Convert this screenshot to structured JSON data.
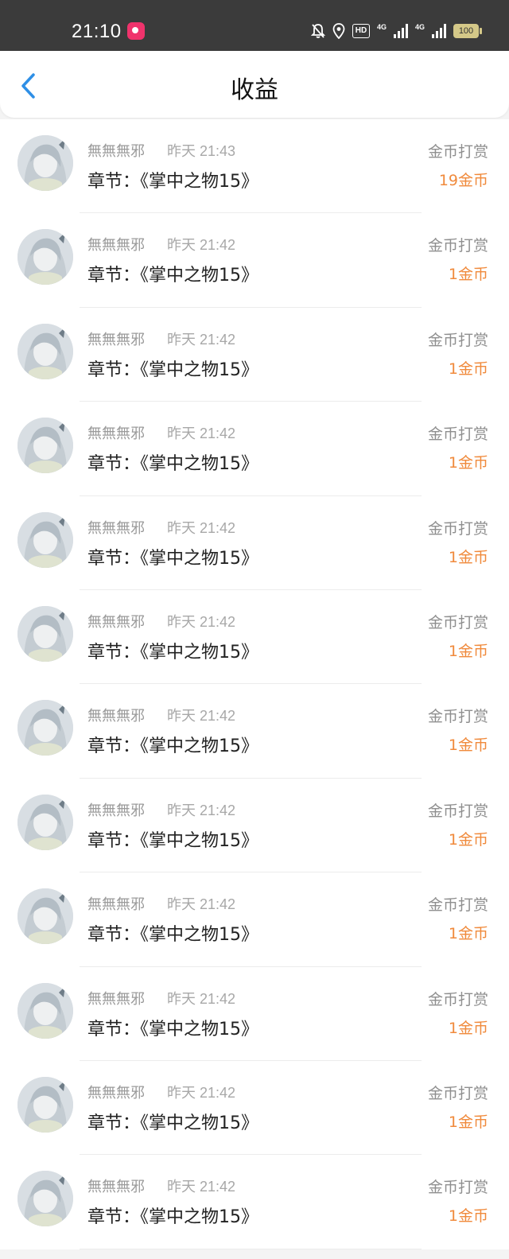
{
  "status_bar": {
    "time": "21:10",
    "hd_label": "HD",
    "net1": "4G",
    "net2": "4G",
    "battery": "100"
  },
  "header": {
    "title": "收益",
    "back_icon": "chevron-left-icon"
  },
  "colors": {
    "accent_back": "#2e8fe6",
    "amount": "#f08a3c",
    "status_bar_bg": "#3b3b3b"
  },
  "records": [
    {
      "user": "無無無邪",
      "time": "昨天 21:43",
      "chapter": "章节：《掌中之物15》",
      "type": "金币打赏",
      "amount": "19金币"
    },
    {
      "user": "無無無邪",
      "time": "昨天 21:42",
      "chapter": "章节：《掌中之物15》",
      "type": "金币打赏",
      "amount": "1金币"
    },
    {
      "user": "無無無邪",
      "time": "昨天 21:42",
      "chapter": "章节：《掌中之物15》",
      "type": "金币打赏",
      "amount": "1金币"
    },
    {
      "user": "無無無邪",
      "time": "昨天 21:42",
      "chapter": "章节：《掌中之物15》",
      "type": "金币打赏",
      "amount": "1金币"
    },
    {
      "user": "無無無邪",
      "time": "昨天 21:42",
      "chapter": "章节：《掌中之物15》",
      "type": "金币打赏",
      "amount": "1金币"
    },
    {
      "user": "無無無邪",
      "time": "昨天 21:42",
      "chapter": "章节：《掌中之物15》",
      "type": "金币打赏",
      "amount": "1金币"
    },
    {
      "user": "無無無邪",
      "time": "昨天 21:42",
      "chapter": "章节：《掌中之物15》",
      "type": "金币打赏",
      "amount": "1金币"
    },
    {
      "user": "無無無邪",
      "time": "昨天 21:42",
      "chapter": "章节：《掌中之物15》",
      "type": "金币打赏",
      "amount": "1金币"
    },
    {
      "user": "無無無邪",
      "time": "昨天 21:42",
      "chapter": "章节：《掌中之物15》",
      "type": "金币打赏",
      "amount": "1金币"
    },
    {
      "user": "無無無邪",
      "time": "昨天 21:42",
      "chapter": "章节：《掌中之物15》",
      "type": "金币打赏",
      "amount": "1金币"
    },
    {
      "user": "無無無邪",
      "time": "昨天 21:42",
      "chapter": "章节：《掌中之物15》",
      "type": "金币打赏",
      "amount": "1金币"
    },
    {
      "user": "無無無邪",
      "time": "昨天 21:42",
      "chapter": "章节：《掌中之物15》",
      "type": "金币打赏",
      "amount": "1金币"
    }
  ]
}
